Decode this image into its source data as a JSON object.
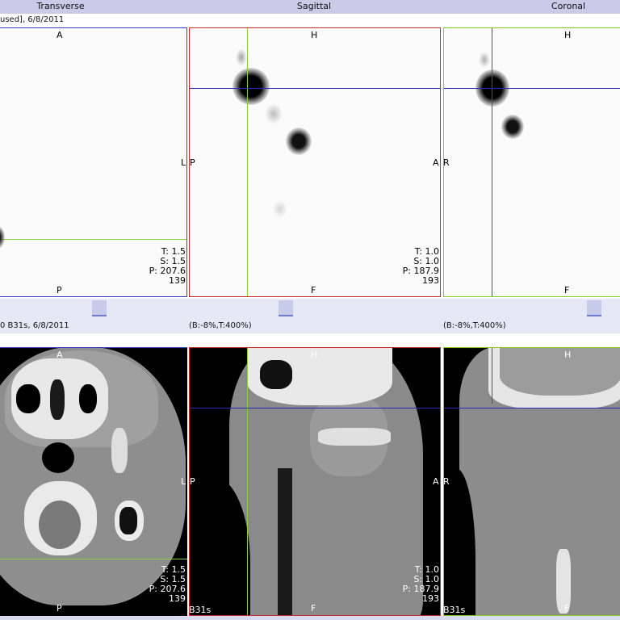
{
  "header": {
    "transverse": "Transverse",
    "sagittal": "Sagittal",
    "coronal": "Coronal",
    "pet_series": "used], 6/8/2011",
    "ct_series": "0 B31s, 6/8/2011",
    "window_sagittal": "(B:-8%,T:400%)",
    "window_coronal": "(B:-8%,T:400%)"
  },
  "orientation": {
    "anterior": "A",
    "posterior": "P",
    "head": "H",
    "foot": "F",
    "left": "L",
    "right": "R"
  },
  "transverse_info": {
    "thickness": "T: 1.5",
    "spacing": "S: 1.5",
    "position": "P: 207.6",
    "slice": "139"
  },
  "sagittal_info": {
    "thickness": "T: 1.0",
    "spacing": "S: 1.0",
    "position": "P: 187.9",
    "slice": "193"
  },
  "ct_kernel": "B31s",
  "colors": {
    "header_bg": "#c8cce8",
    "transverse_border": "#3a3acc",
    "sagittal_border": "#cc2a2a",
    "coronal_border": "#88cc22",
    "crosshair_blue": "#2a2ab8",
    "crosshair_green": "#88d040",
    "crosshair_red": "#cc2020"
  }
}
